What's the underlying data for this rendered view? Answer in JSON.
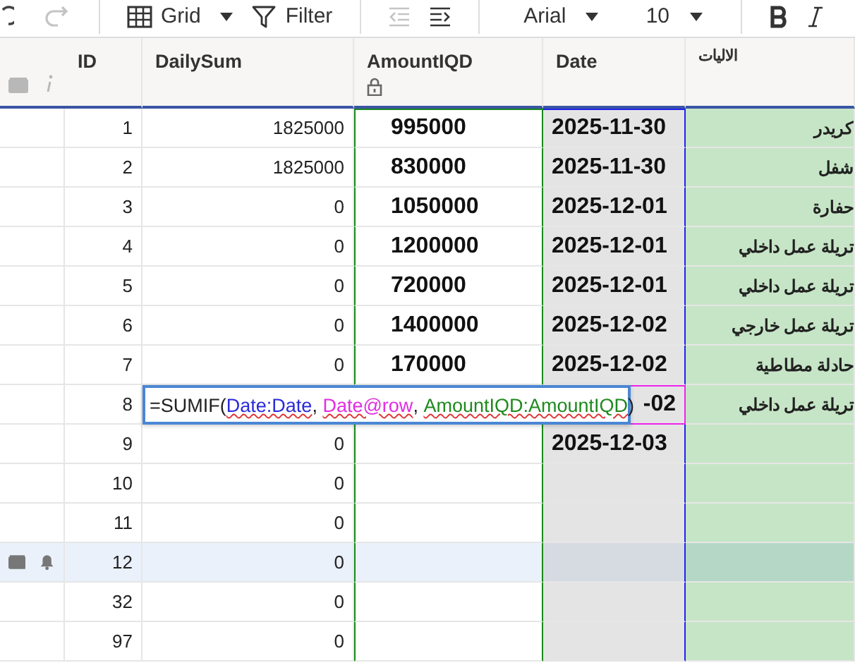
{
  "toolbar": [
    {
      "kind": "undo",
      "disabled": false
    },
    {
      "kind": "redo",
      "disabled": true
    },
    {
      "kind": "view",
      "label": "Grid"
    },
    {
      "kind": "filter",
      "label": "Filter"
    },
    {
      "kind": "outdent",
      "disabled": true
    },
    {
      "kind": "indent",
      "disabled": false
    },
    {
      "kind": "font",
      "label": "Arial"
    },
    {
      "kind": "size",
      "label": "10"
    },
    {
      "kind": "bold"
    },
    {
      "kind": "italic"
    }
  ],
  "columns": [
    {
      "name": "ID",
      "locked": false
    },
    {
      "name": "DailySum",
      "locked": false
    },
    {
      "name": "AmountIQD",
      "locked": true
    },
    {
      "name": "Date",
      "locked": false
    },
    {
      "name": "الاليات",
      "locked": false
    }
  ],
  "rows": [
    {
      "id": "1",
      "daily_sum": "1825000",
      "amount": "995000",
      "date": "2025-11-30",
      "machine": "كريدر",
      "selected": false,
      "editing": false
    },
    {
      "id": "2",
      "daily_sum": "1825000",
      "amount": "830000",
      "date": "2025-11-30",
      "machine": "شفل",
      "selected": false,
      "editing": false
    },
    {
      "id": "3",
      "daily_sum": "0",
      "amount": "1050000",
      "date": "2025-12-01",
      "machine": "حفارة",
      "selected": false,
      "editing": false
    },
    {
      "id": "4",
      "daily_sum": "0",
      "amount": "1200000",
      "date": "2025-12-01",
      "machine": "تريلة عمل داخلي",
      "selected": false,
      "editing": false
    },
    {
      "id": "5",
      "daily_sum": "0",
      "amount": "720000",
      "date": "2025-12-01",
      "machine": "تريلة عمل داخلي",
      "selected": false,
      "editing": false
    },
    {
      "id": "6",
      "daily_sum": "0",
      "amount": "1400000",
      "date": "2025-12-02",
      "machine": "تريلة عمل خارجي",
      "selected": false,
      "editing": false
    },
    {
      "id": "7",
      "daily_sum": "0",
      "amount": "170000",
      "date": "2025-12-02",
      "machine": "حادلة مطاطية",
      "selected": false,
      "editing": false
    },
    {
      "id": "8",
      "date": "-02",
      "machine": "تريلة عمل داخلي",
      "selected": false,
      "editing": true
    },
    {
      "id": "9",
      "daily_sum": "0",
      "date": "2025-12-03",
      "selected": false,
      "editing": false
    },
    {
      "id": "10",
      "daily_sum": "0",
      "selected": false,
      "editing": false
    },
    {
      "id": "11",
      "daily_sum": "0",
      "selected": false,
      "editing": false
    },
    {
      "id": "12",
      "daily_sum": "0",
      "selected": true,
      "editing": false
    },
    {
      "id": "32",
      "daily_sum": "0",
      "selected": false,
      "editing": false
    },
    {
      "id": "97",
      "daily_sum": "0",
      "selected": false,
      "editing": false
    }
  ],
  "formula_editor": {
    "segments": [
      {
        "text": "=SUMIF("
      },
      {
        "text": "Date:Date",
        "color": "#2b2bdb"
      },
      {
        "text": ", "
      },
      {
        "text": "Date@row",
        "color": "#e12ee1"
      },
      {
        "text": ", "
      },
      {
        "text": "AmountIQD:AmountIQD",
        "color": "#1f8a1f"
      },
      {
        "text": ")"
      }
    ]
  }
}
